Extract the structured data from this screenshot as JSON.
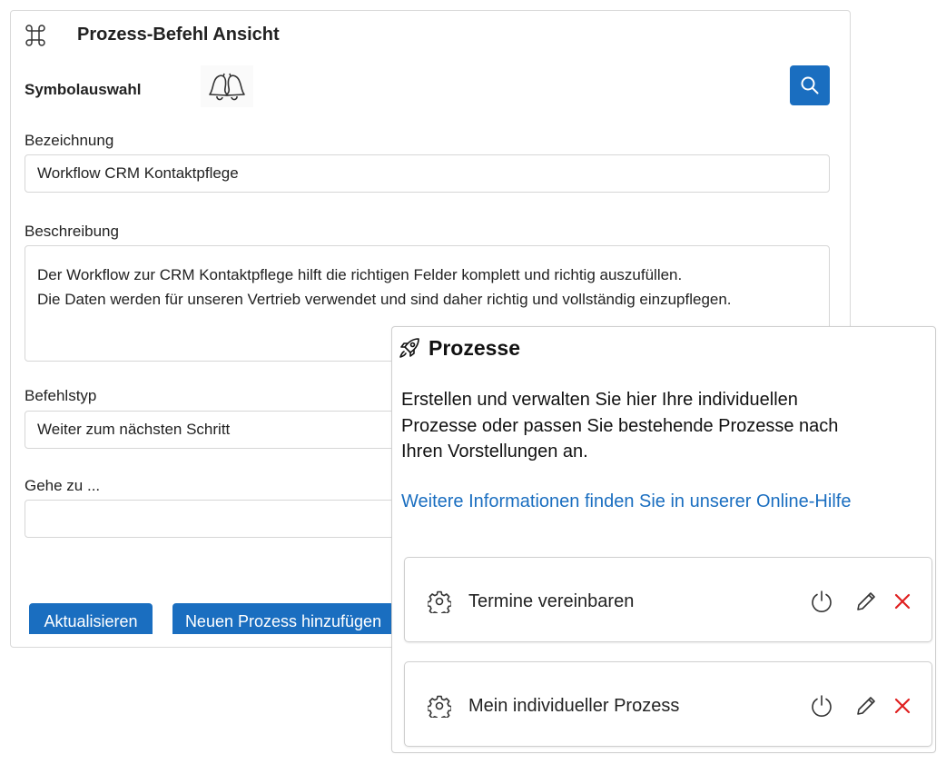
{
  "editor": {
    "title": "Prozess-Befehl Ansicht",
    "title_icon": "command-icon",
    "symbol_label": "Symbolauswahl",
    "symbol_icon": "bell-icon",
    "search_icon": "search-icon",
    "name_label": "Bezeichnung",
    "name_value": "Workflow CRM Kontaktpflege",
    "description_label": "Beschreibung",
    "description_lines": [
      "Der Workflow zur CRM Kontaktpflege hilft die richtigen Felder komplett und richtig auszufüllen.",
      "Die Daten werden für unseren Vertrieb verwendet und sind daher richtig und vollständig einzupflegen."
    ],
    "command_type_label": "Befehlstyp",
    "command_type_value": "Weiter zum nächsten Schritt",
    "goto_label": "Gehe zu ...",
    "goto_value": "",
    "update_button": "Aktualisieren",
    "add_process_button": "Neuen Prozess hinzufügen",
    "accent_color": "#1a6ec0"
  },
  "processes_panel": {
    "title": "Prozesse",
    "title_icon": "rocket-icon",
    "description_lines": [
      "Erstellen und verwalten Sie hier Ihre individuellen",
      "Prozesse oder passen Sie bestehende Prozesse nach",
      "Ihren Vorstellungen an."
    ],
    "help_link": "Weitere Informationen finden Sie in unserer Online-Hilfe",
    "items": [
      {
        "name": "Termine vereinbaren",
        "icon": "gear-icon",
        "actions": [
          "power-icon",
          "pencil-icon",
          "close-icon"
        ]
      },
      {
        "name": "Mein individueller Prozess",
        "icon": "gear-icon",
        "actions": [
          "power-icon",
          "pencil-icon",
          "close-icon"
        ]
      }
    ],
    "delete_color": "#e02020"
  }
}
